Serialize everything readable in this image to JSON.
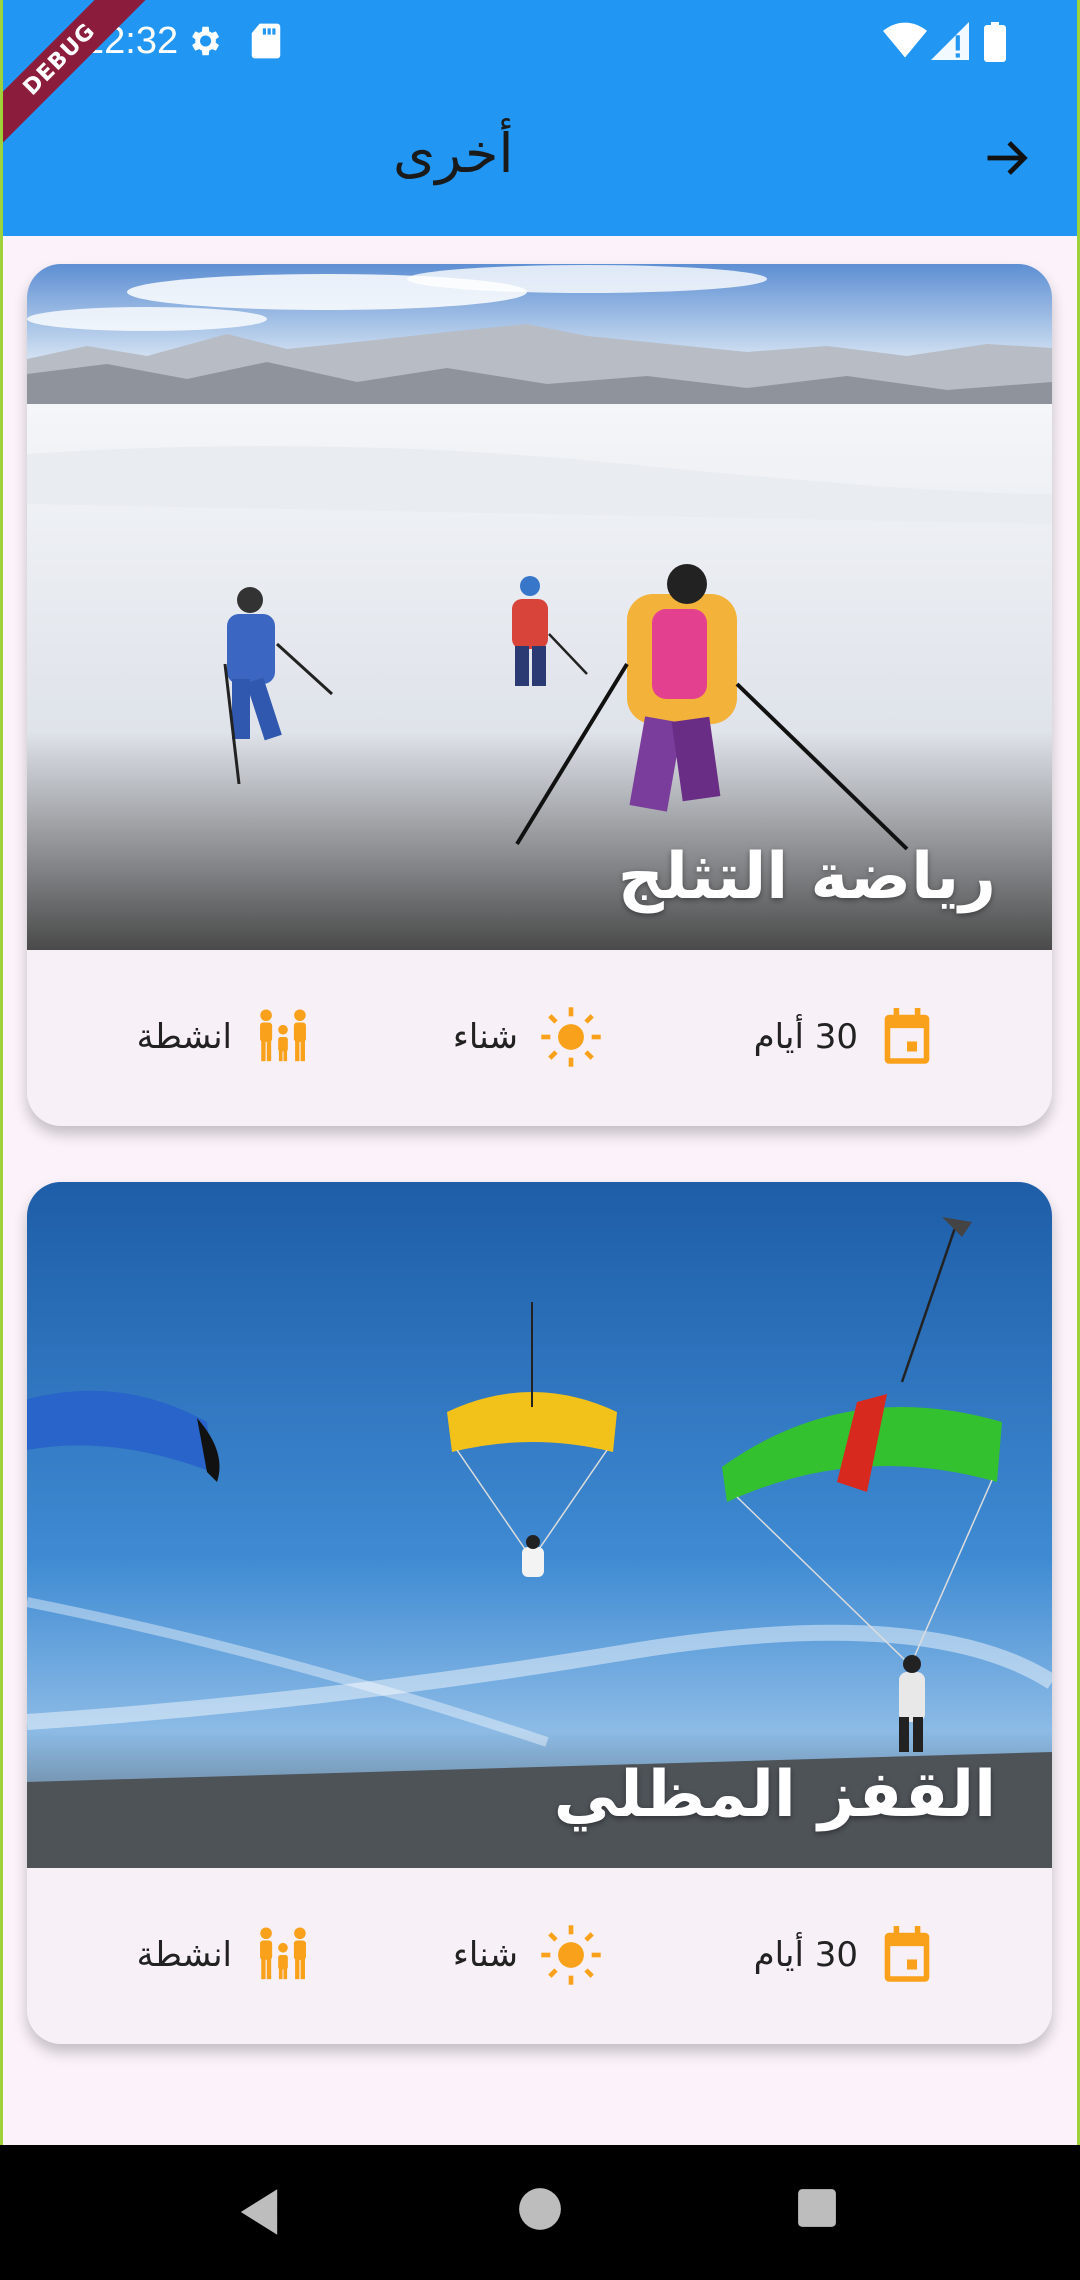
{
  "status_bar": {
    "time": "12:32",
    "debug_label": "DEBUG",
    "icons": [
      "gear-icon",
      "sd-card-icon",
      "wifi-icon",
      "signal-icon",
      "battery-icon"
    ]
  },
  "app_bar": {
    "title": "أخرى",
    "back_icon": "arrow-forward-icon",
    "color": "#2196f3"
  },
  "cards": [
    {
      "title": "رياضة التثلج",
      "image": "skiing-photo",
      "info": {
        "duration": "30 أيام",
        "season": "شناء",
        "category": "انشطة"
      }
    },
    {
      "title": "القفز المظلي",
      "image": "paragliding-photo",
      "info": {
        "duration": "30 أيام",
        "season": "شناء",
        "category": "انشطة"
      }
    }
  ],
  "accent_color": "#f9a11b",
  "nav_bar": {
    "buttons": [
      "back-triangle-icon",
      "home-circle-icon",
      "recents-square-icon"
    ]
  }
}
